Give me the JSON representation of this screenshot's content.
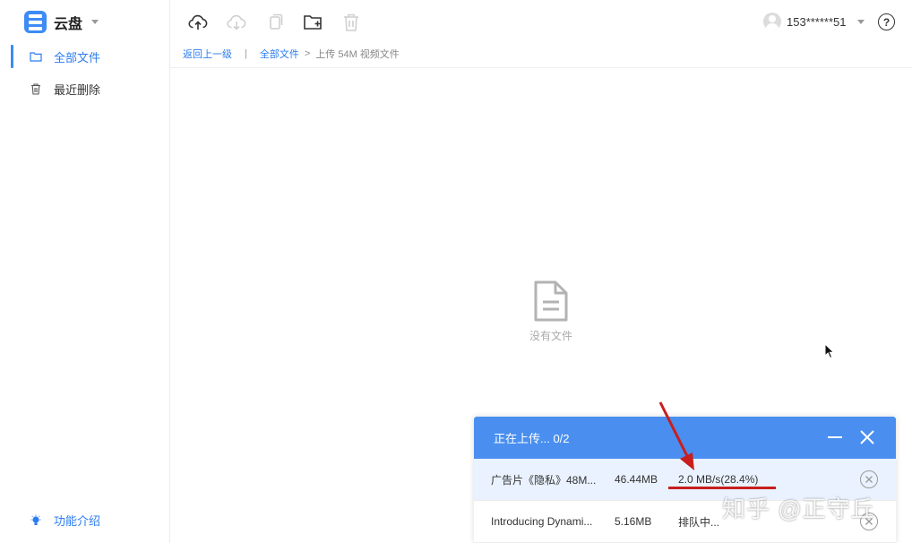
{
  "brand": {
    "name": "云盘"
  },
  "sidebar": {
    "items": [
      {
        "label": "全部文件",
        "icon": "folder-icon",
        "active": true
      },
      {
        "label": "最近删除",
        "icon": "trash-icon",
        "active": false
      }
    ],
    "feature_label": "功能介绍"
  },
  "toolbar": {
    "buttons": [
      "upload-icon",
      "download-icon",
      "copy-icon",
      "new-folder-icon",
      "delete-icon"
    ]
  },
  "user": {
    "name": "153******51"
  },
  "help": {
    "label": "?"
  },
  "breadcrumb": {
    "back": "返回上一级",
    "separator": "|",
    "root": "全部文件",
    "arrow": ">",
    "current": "上传 54M 视频文件"
  },
  "empty": {
    "label": "没有文件"
  },
  "upload_panel": {
    "title": "正在上传... 0/2",
    "rows": [
      {
        "name": "广告片《隐私》48M...",
        "size": "46.44MB",
        "status": "2.0 MB/s(28.4%)",
        "progress": 0.284
      },
      {
        "name": "Introducing Dynami...",
        "size": "5.16MB",
        "status": "排队中..."
      }
    ]
  },
  "watermark": "知乎 @正守丘",
  "colors": {
    "accent": "#3d8bf5",
    "panel_header": "#4a8ff0",
    "annotation": "#c81e1e"
  }
}
